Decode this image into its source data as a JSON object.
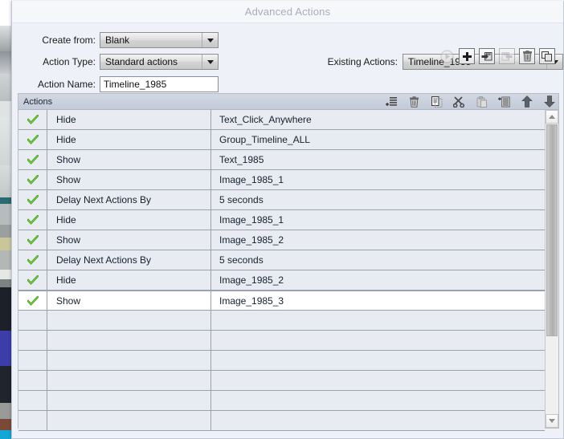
{
  "window": {
    "title": "Advanced Actions"
  },
  "form": {
    "create_from": {
      "label": "Create from:",
      "value": "Blank"
    },
    "action_type": {
      "label": "Action Type:",
      "value": "Standard actions"
    },
    "action_name": {
      "label": "Action Name:",
      "value": "Timeline_1985"
    },
    "existing_actions": {
      "label": "Existing Actions:",
      "value": "Timeline_1985"
    }
  },
  "toolbar": {
    "buttons": [
      {
        "name": "preview-button",
        "icon": "play-icon",
        "enabled": false
      },
      {
        "name": "add-button",
        "icon": "plus-icon",
        "enabled": true
      },
      {
        "name": "save-as-button",
        "icon": "save-arrow-icon",
        "enabled": true
      },
      {
        "name": "import-button",
        "icon": "import-arrow-icon",
        "enabled": false
      },
      {
        "name": "delete-button",
        "icon": "trash-icon",
        "enabled": true
      },
      {
        "name": "duplicate-button",
        "icon": "copy-icon",
        "enabled": true
      }
    ]
  },
  "panel": {
    "title": "Actions",
    "header_icons": [
      {
        "name": "insert-row-button",
        "icon": "insert-list-icon"
      },
      {
        "name": "delete-row-button",
        "icon": "trash-icon"
      },
      {
        "name": "copy-row-button",
        "icon": "copy-page-icon"
      },
      {
        "name": "cut-row-button",
        "icon": "scissors-icon"
      },
      {
        "name": "paste-row-button",
        "icon": "paste-icon"
      },
      {
        "name": "append-row-button",
        "icon": "append-list-icon"
      },
      {
        "name": "move-up-button",
        "icon": "arrow-up-icon"
      },
      {
        "name": "move-down-button",
        "icon": "arrow-down-icon"
      }
    ]
  },
  "table": {
    "rows": [
      {
        "enabled": true,
        "action": "Hide",
        "target": "Text_Click_Anywhere",
        "selected": false
      },
      {
        "enabled": true,
        "action": "Hide",
        "target": "Group_Timeline_ALL",
        "selected": false
      },
      {
        "enabled": true,
        "action": "Show",
        "target": "Text_1985",
        "selected": false
      },
      {
        "enabled": true,
        "action": "Show",
        "target": "Image_1985_1",
        "selected": false
      },
      {
        "enabled": true,
        "action": "Delay Next Actions By",
        "target": "5   seconds",
        "selected": false
      },
      {
        "enabled": true,
        "action": "Hide",
        "target": "Image_1985_1",
        "selected": false
      },
      {
        "enabled": true,
        "action": "Show",
        "target": "Image_1985_2",
        "selected": false
      },
      {
        "enabled": true,
        "action": "Delay Next Actions By",
        "target": "5   seconds",
        "selected": false
      },
      {
        "enabled": true,
        "action": "Hide",
        "target": "Image_1985_2",
        "selected": false
      },
      {
        "enabled": true,
        "action": "Show",
        "target": "Image_1985_3",
        "selected": true
      },
      {
        "enabled": false,
        "action": "",
        "target": "",
        "selected": false
      },
      {
        "enabled": false,
        "action": "",
        "target": "",
        "selected": false
      },
      {
        "enabled": false,
        "action": "",
        "target": "",
        "selected": false
      },
      {
        "enabled": false,
        "action": "",
        "target": "",
        "selected": false
      },
      {
        "enabled": false,
        "action": "",
        "target": "",
        "selected": false
      },
      {
        "enabled": false,
        "action": "",
        "target": "",
        "selected": false
      }
    ]
  },
  "colors": {
    "checkmark_green": "#3fa21a",
    "dialog_bg": "#eef1f7",
    "panel_bg": "#e8ebf2",
    "header_bg": "#c8cfdb",
    "title_text": "#a8adb8"
  }
}
